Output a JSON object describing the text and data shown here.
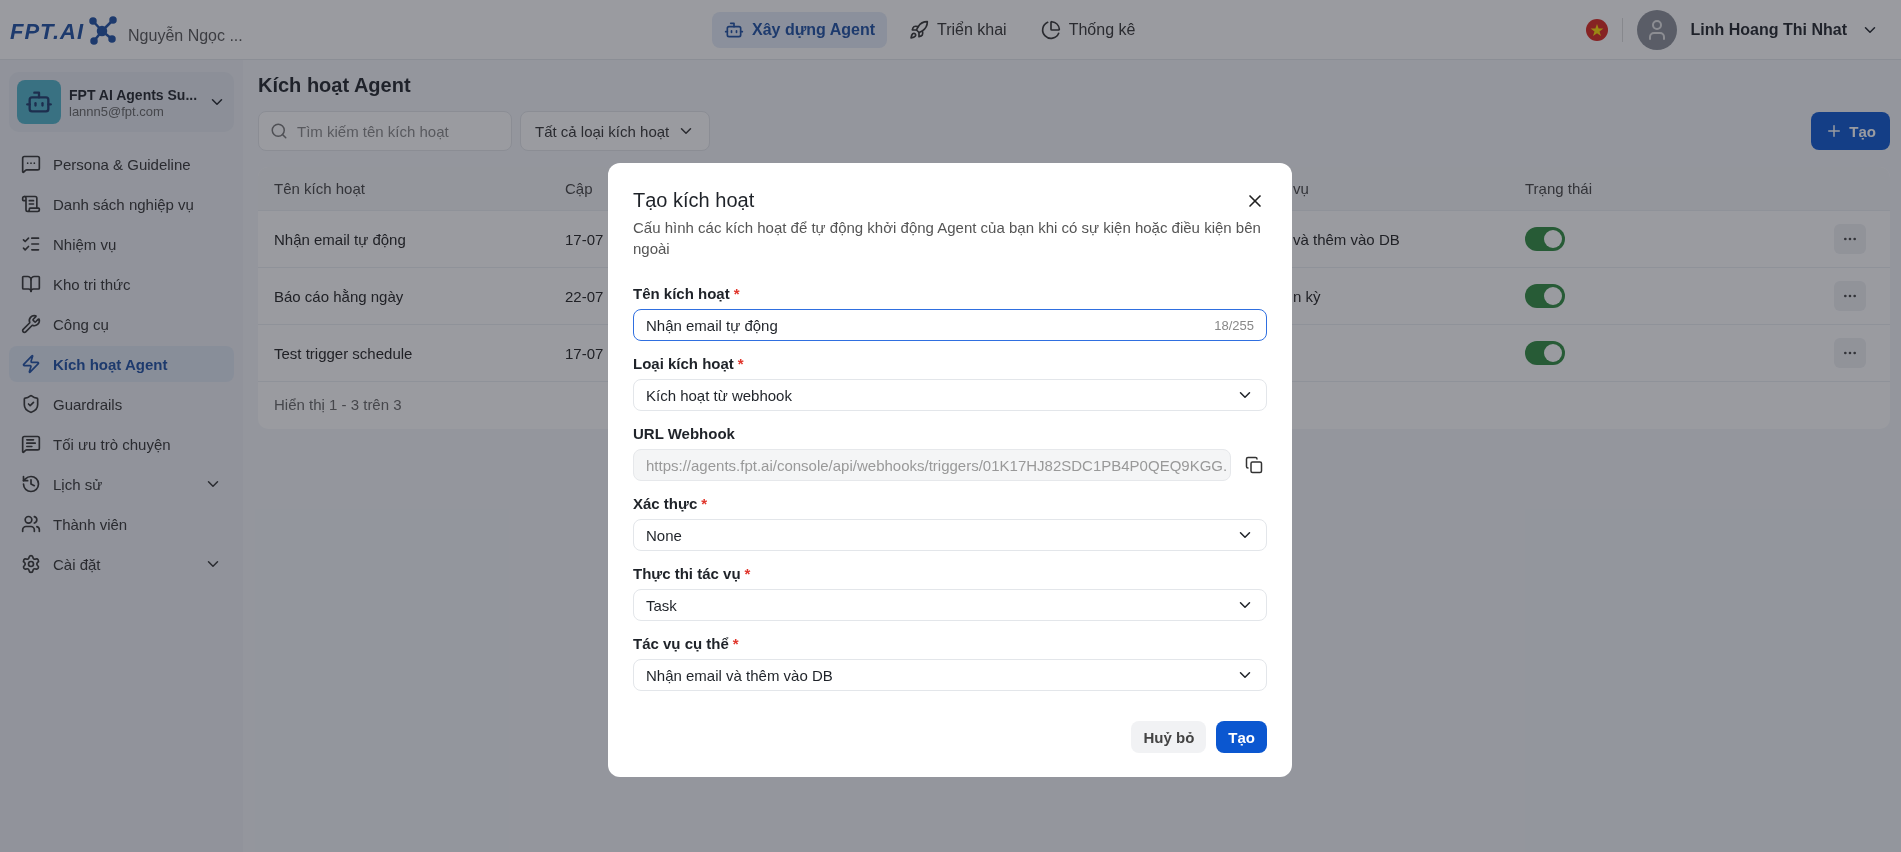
{
  "header": {
    "logo": "FPT.AI",
    "workspace_owner": "Nguyễn Ngọc ...",
    "nav": [
      {
        "label": "Xây dựng Agent",
        "selected": true
      },
      {
        "label": "Triển khai",
        "selected": false
      },
      {
        "label": "Thống kê",
        "selected": false
      }
    ],
    "user": {
      "name": "Linh Hoang Thi Nhat"
    }
  },
  "sidebar": {
    "workspace": {
      "name": "FPT AI Agents Su...",
      "email": "lannn5@fpt.com"
    },
    "items": [
      {
        "label": "Persona & Guideline",
        "selected": false,
        "expandable": false
      },
      {
        "label": "Danh sách nghiệp vụ",
        "selected": false,
        "expandable": false
      },
      {
        "label": "Nhiệm vụ",
        "selected": false,
        "expandable": false
      },
      {
        "label": "Kho tri thức",
        "selected": false,
        "expandable": false
      },
      {
        "label": "Công cụ",
        "selected": false,
        "expandable": false
      },
      {
        "label": "Kích hoạt Agent",
        "selected": true,
        "expandable": false
      },
      {
        "label": "Guardrails",
        "selected": false,
        "expandable": false
      },
      {
        "label": "Tối ưu trò chuyện",
        "selected": false,
        "expandable": false
      },
      {
        "label": "Lịch sử",
        "selected": false,
        "expandable": true
      },
      {
        "label": "Thành viên",
        "selected": false,
        "expandable": false
      },
      {
        "label": "Cài đặt",
        "selected": false,
        "expandable": true
      }
    ]
  },
  "page": {
    "title": "Kích hoạt Agent",
    "search": {
      "placeholder": "Tìm kiếm tên kích hoạt"
    },
    "filter": "Tất cả loại kích hoạt",
    "create_button": "Tạo"
  },
  "table": {
    "columns": [
      "Tên kích hoạt",
      "Cập",
      "vụ",
      "Trạng thái"
    ],
    "rows": [
      {
        "name": "Nhận email tự động",
        "column_2": "17-07",
        "column_3": "và thêm vào DB",
        "on": true
      },
      {
        "name": "Báo cáo hằng ngày",
        "column_2": "22-07",
        "column_3": "n kỳ",
        "on": true
      },
      {
        "name": "Test trigger schedule",
        "column_2": "17-07",
        "column_3": "",
        "on": true
      }
    ],
    "footer": "Hiển thị 1 - 3 trên 3"
  },
  "modal": {
    "title": "Tạo kích hoạt",
    "description": "Cấu hình các kích hoạt để tự động khởi động Agent của bạn khi có sự kiện hoặc điều kiện bên ngoài",
    "fields": [
      {
        "kind": "text",
        "label": "Tên kích hoạt",
        "required": true,
        "value": "Nhận email tự động",
        "counter": "18/255"
      },
      {
        "kind": "select",
        "label": "Loại kích hoạt",
        "required": true,
        "value": "Kích hoạt từ webhook"
      },
      {
        "kind": "readonly",
        "label": "URL Webhook",
        "required": false,
        "value": "https://agents.fpt.ai/console/api/webhooks/triggers/01K17HJ82SDC1PB4P0QEQ9KGG."
      },
      {
        "kind": "select",
        "label": "Xác thực",
        "required": true,
        "value": "None"
      },
      {
        "kind": "select",
        "label": "Thực thi tác vụ",
        "required": true,
        "value": "Task"
      },
      {
        "kind": "select",
        "label": "Tác vụ cụ thể",
        "required": true,
        "value": "Nhận email và thêm vào DB"
      }
    ],
    "required_mark": "*",
    "cancel_button": "Huỷ bỏ",
    "submit_button": "Tạo"
  }
}
